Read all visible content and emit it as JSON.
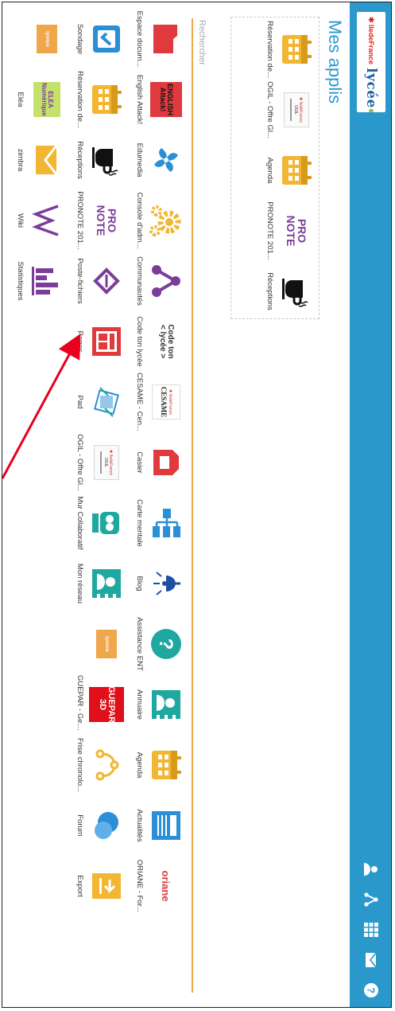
{
  "header": {
    "brand_region": "✱ îledeFrance",
    "brand_name": "lycée",
    "icons": [
      "user-icon",
      "network-icon",
      "apps-grid-icon",
      "mail-icon",
      "help-icon"
    ]
  },
  "title": "Mes applis",
  "search": {
    "placeholder": "Rechercher"
  },
  "favorites": [
    {
      "label": "Réservation de...",
      "icon": "calendar-icon"
    },
    {
      "label": "OGIL - Offre Gl...",
      "icon": "ogil-thumbnail"
    },
    {
      "label": "Agenda",
      "icon": "calendar-icon"
    },
    {
      "label": "PRONOTE 201...",
      "icon": "pronote-logo"
    },
    {
      "label": "Réceptions",
      "icon": "coffee-cup-icon"
    }
  ],
  "apps_row1": [
    {
      "label": "Espace docum...",
      "icon": "folder-icon"
    },
    {
      "label": "English Attack!",
      "icon": "english-attack-logo"
    },
    {
      "label": "Edumedia",
      "icon": "fan-icon"
    },
    {
      "label": "Console d'adm...",
      "icon": "gears-icon"
    },
    {
      "label": "Communautés",
      "icon": "share-icon"
    },
    {
      "label": "Code ton lycée",
      "icon": "code-ton-lycee-logo"
    },
    {
      "label": "CESAME - Cen...",
      "icon": "cesame-logo"
    },
    {
      "label": "Casier",
      "icon": "locker-icon"
    },
    {
      "label": "Carte mentale",
      "icon": "mindmap-icon"
    },
    {
      "label": "Blog",
      "icon": "lamp-icon"
    },
    {
      "label": "Assistance ENT",
      "icon": "help-bubble-icon"
    },
    {
      "label": "Annuaire",
      "icon": "contact-card-icon"
    },
    {
      "label": "Agenda",
      "icon": "calendar-icon"
    },
    {
      "label": "Actualités",
      "icon": "newspaper-icon"
    },
    {
      "label": "ORIANE - For...",
      "icon": "oriane-logo"
    }
  ],
  "apps_row2": [
    {
      "label": "Sondage",
      "icon": "poll-check-icon"
    },
    {
      "label": "Réservation de...",
      "icon": "calendar-icon"
    },
    {
      "label": "Réceptions",
      "icon": "coffee-cup-icon"
    },
    {
      "label": "PRONOTE 201...",
      "icon": "pronote-logo"
    },
    {
      "label": "Poste-fichiers",
      "icon": "file-post-icon"
    },
    {
      "label": "Pages",
      "icon": "pages-icon"
    },
    {
      "label": "Pad",
      "icon": "pad-icon"
    },
    {
      "label": "OGIL - Offre Gl...",
      "icon": "ogil-thumbnail"
    },
    {
      "label": "Mur Collaboratif",
      "icon": "collaborative-wall-icon"
    },
    {
      "label": "Mon réseau",
      "icon": "contact-card-icon"
    },
    {
      "label": "",
      "icon": "lystore-logo"
    },
    {
      "label": "GUEPAR - Gest...",
      "icon": "guepar-logo"
    },
    {
      "label": "Frise chronolo...",
      "icon": "timeline-icon"
    },
    {
      "label": "Forum",
      "icon": "forum-bubbles-icon"
    },
    {
      "label": "Export",
      "icon": "export-folder-icon"
    }
  ],
  "apps_row3": [
    {
      "label": "",
      "icon": "lystore-logo"
    },
    {
      "label": "Eléa",
      "icon": "elea-logo"
    },
    {
      "label": "zimbra",
      "icon": "mail-envelope-icon"
    },
    {
      "label": "Wiki",
      "icon": "wiki-icon"
    },
    {
      "label": "Statistiques",
      "icon": "bar-chart-icon"
    }
  ],
  "logos": {
    "oriane": "oriane",
    "pronote": "PRO NOTE",
    "english_attack": "ENGLISH Attack!",
    "cesame_region": "✱ îledeFrance",
    "cesame": "CESAME",
    "code_ton_lycee": "Code ton < lycée >",
    "guepar": "GUEPAR 3D",
    "elea": "ELEA Numérique",
    "lystore": "lystore",
    "ogil_region": "✱ îledeFrance",
    "ogil_text": "OGIL"
  },
  "colors": {
    "header": "#2b98cc",
    "title": "#2b98cc",
    "search_underline": "#f0a64a",
    "red_icon": "#e03a3e",
    "teal_icon": "#1fa8a0",
    "yellow_icon": "#f2b632",
    "blue_icon": "#2b8fd6",
    "purple_icon": "#7b3d99",
    "annotation_arrow": "#e8001c"
  }
}
